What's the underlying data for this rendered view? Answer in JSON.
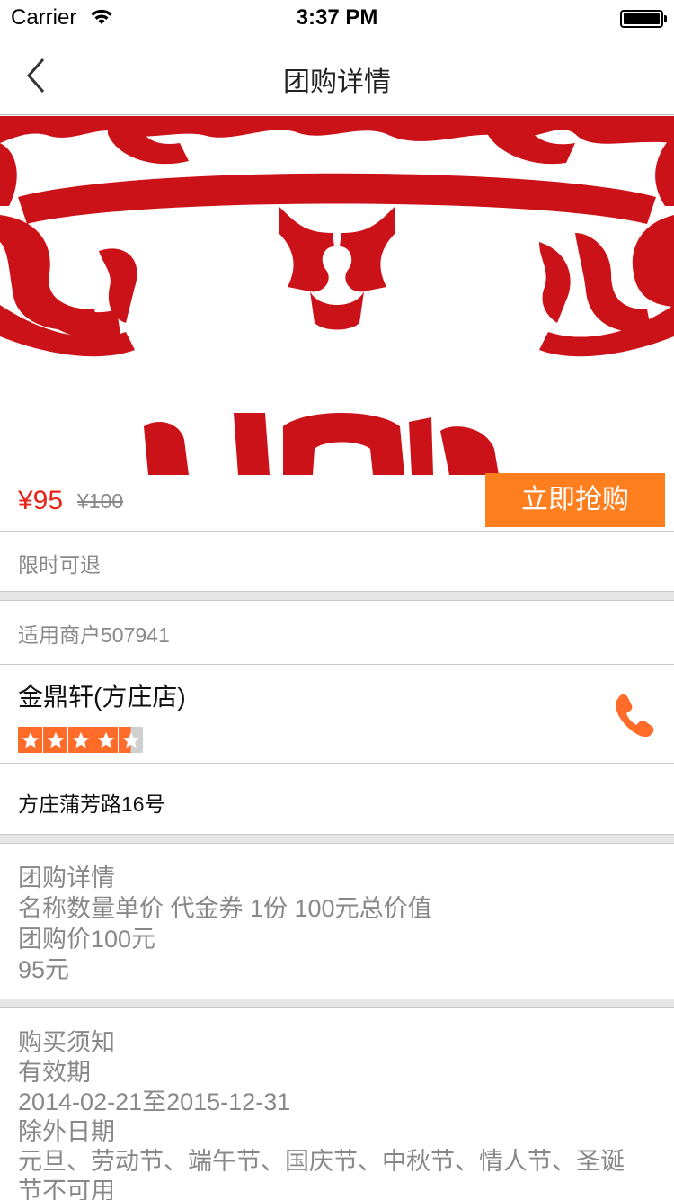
{
  "status_bar": {
    "carrier": "Carrier",
    "time": "3:37 PM"
  },
  "nav": {
    "title": "团购详情"
  },
  "hero": {
    "image_colors": {
      "primary": "#cc1219",
      "background": "#ffffff"
    }
  },
  "price": {
    "current": "¥95",
    "original": "¥100",
    "buy_label": "立即抢购"
  },
  "refund": {
    "text": "限时可退"
  },
  "merchant": {
    "header": "适用商户507941",
    "name": "金鼎轩(方庄店)",
    "rating": 4.5,
    "rating_max": 5,
    "address": "方庄蒲芳路16号"
  },
  "details": {
    "lines": [
      "团购详情",
      "名称数量单价 代金券 1份 100元总价值",
      "团购价100元",
      "95元"
    ]
  },
  "notice": {
    "lines": [
      "购买须知",
      "有效期",
      "2014-02-21至2015-12-31",
      "除外日期",
      "元旦、劳动节、端午节、国庆节、中秋节、情人节、圣诞",
      "节不可用"
    ]
  },
  "colors": {
    "accent": "#ff7f1f",
    "price": "#e8231a",
    "star": "#ff6b28"
  }
}
